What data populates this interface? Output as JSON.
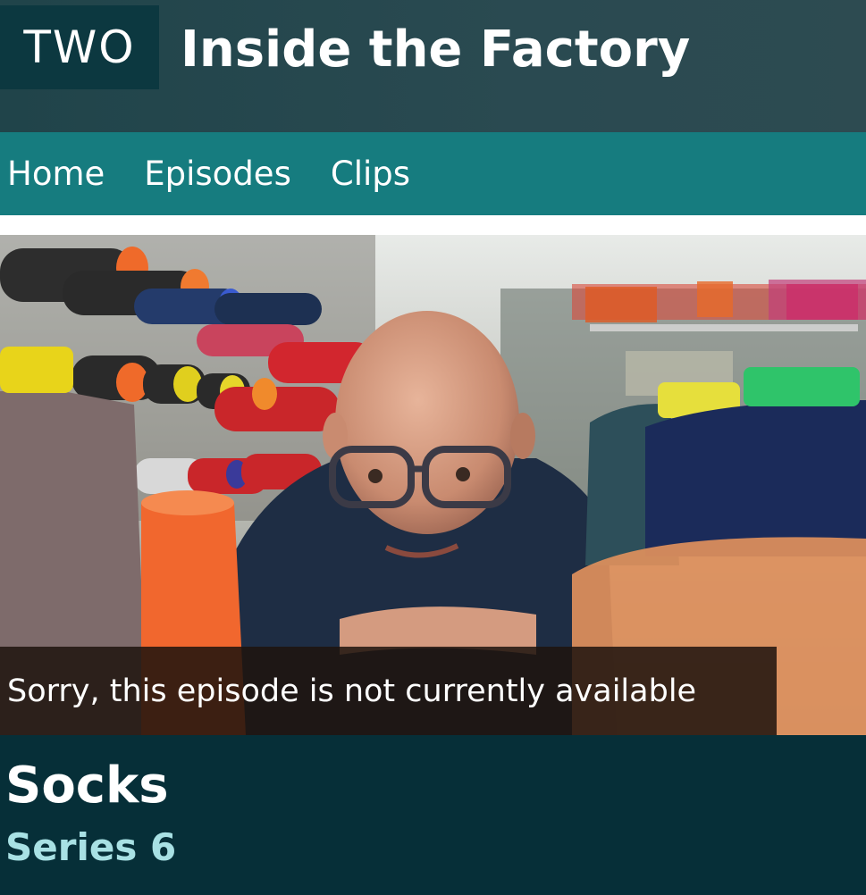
{
  "header": {
    "channel": "TWO",
    "brand_title": "Inside the Factory"
  },
  "nav": {
    "items": [
      {
        "label": "Home"
      },
      {
        "label": "Episodes"
      },
      {
        "label": "Clips"
      }
    ]
  },
  "hero": {
    "image": "presenter-with-thread-cones-photo",
    "message": "Sorry, this episode is not currently available"
  },
  "episode": {
    "title": "Socks",
    "series": "Series 6"
  },
  "colors": {
    "header_bg": "#2a4a51",
    "logo_bg": "#0c3840",
    "nav_bg": "#167c7f",
    "info_bg": "#062f38",
    "series_text": "#a8e1e4"
  }
}
